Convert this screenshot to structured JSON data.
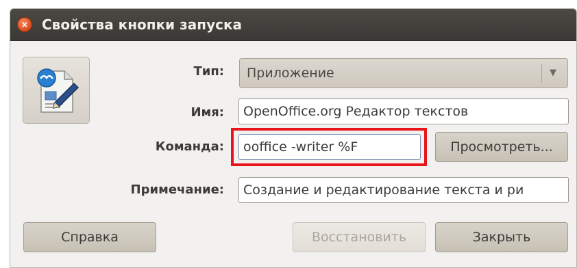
{
  "window": {
    "title": "Свойства кнопки запуска",
    "close_glyph": "×"
  },
  "form": {
    "type_label": "Тип:",
    "type_value": "Приложение",
    "name_label": "Имя:",
    "name_value": "OpenOffice.org Редактор текстов",
    "command_label": "Команда:",
    "command_value": "ooffice -writer %F",
    "browse_label": "Просмотреть...",
    "comment_label": "Примечание:",
    "comment_value": "Создание и редактирование текста и ри"
  },
  "buttons": {
    "help_label": "Справка",
    "revert_label": "Восстановить",
    "close_label": "Закрыть"
  },
  "icons": {
    "launcher_icon": "openoffice-writer-icon",
    "dropdown_arrow": "▼"
  },
  "colors": {
    "highlight": "#e8141c",
    "titlebar": "#3f3e3a"
  }
}
